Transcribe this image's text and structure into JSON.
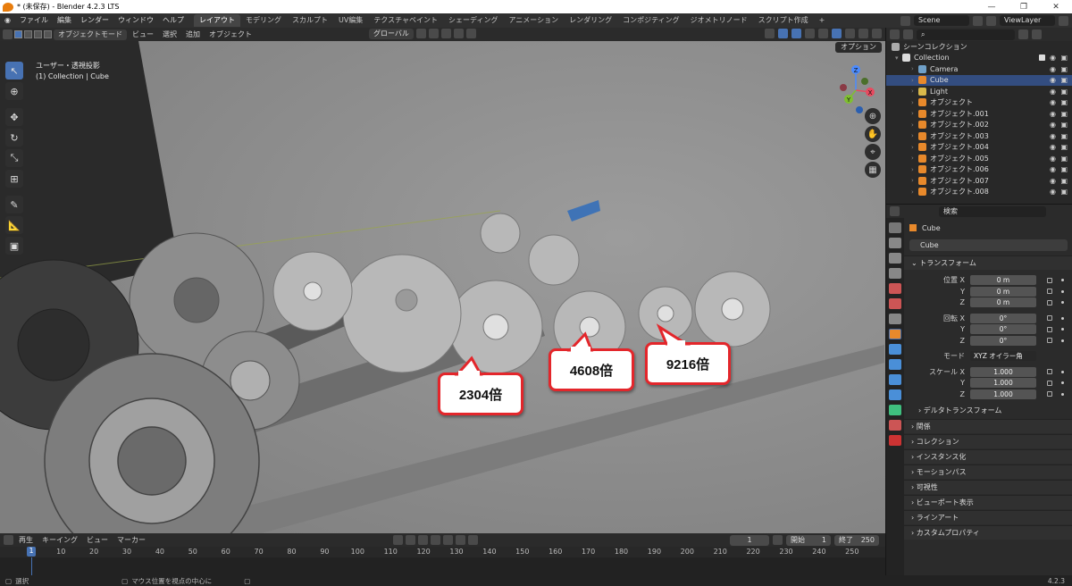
{
  "window": {
    "title": "* (未保存) - Blender 4.2.3 LTS",
    "controls": [
      "—",
      "❐",
      "✕"
    ]
  },
  "menubar": {
    "menus": [
      "ファイル",
      "編集",
      "レンダー",
      "ウィンドウ",
      "ヘルプ"
    ],
    "workspaces": [
      "レイアウト",
      "モデリング",
      "スカルプト",
      "UV編集",
      "テクスチャペイント",
      "シェーディング",
      "アニメーション",
      "レンダリング",
      "コンポジティング",
      "ジオメトリノード",
      "スクリプト作成"
    ],
    "add_tab": "+",
    "scene": "Scene",
    "view_layer": "ViewLayer"
  },
  "viewport": {
    "mode": "オブジェクトモード",
    "menus": [
      "ビュー",
      "選択",
      "追加",
      "オブジェクト"
    ],
    "transform_orientation": "グローバル",
    "options": "オプション",
    "info_line1": "ユーザー・透視投影",
    "info_line2": "(1) Collection | Cube",
    "gizmo_axes": [
      "X",
      "Y",
      "Z"
    ]
  },
  "callouts": [
    "2304倍",
    "4608倍",
    "9216倍"
  ],
  "timeline": {
    "menus": [
      "再生",
      "キーイング",
      "ビュー",
      "マーカー"
    ],
    "current_frame": "1",
    "start_label": "開始",
    "start": "1",
    "end_label": "終了",
    "end": "250",
    "ruler": [
      "1",
      "10",
      "20",
      "30",
      "40",
      "50",
      "60",
      "70",
      "80",
      "90",
      "100",
      "110",
      "120",
      "130",
      "140",
      "150",
      "160",
      "170",
      "180",
      "190",
      "200",
      "210",
      "220",
      "230",
      "240",
      "250"
    ]
  },
  "statusbar": {
    "left": "選択",
    "middle": "マウス位置を視点の中心に",
    "version": "4.2.3"
  },
  "outliner": {
    "search_placeholder": "",
    "root": "シーンコレクション",
    "collection": "Collection",
    "items": [
      "Camera",
      "Cube",
      "Light",
      "オブジェクト",
      "オブジェクト.001",
      "オブジェクト.002",
      "オブジェクト.003",
      "オブジェクト.004",
      "オブジェクト.005",
      "オブジェクト.006",
      "オブジェクト.007",
      "オブジェクト.008"
    ]
  },
  "properties": {
    "search_placeholder": "検索",
    "object_name": "Cube",
    "object_field": "Cube",
    "transform_header": "トランスフォーム",
    "location_label": "位置 X",
    "location": [
      "0 m",
      "0 m",
      "0 m"
    ],
    "rotation_label": "回転 X",
    "rotation": [
      "0°",
      "0°",
      "0°"
    ],
    "mode_label": "モード",
    "mode_value": "XYZ オイラー角",
    "scale_label": "スケール X",
    "scale": [
      "1.000",
      "1.000",
      "1.000"
    ],
    "axis_y": "Y",
    "axis_z": "Z",
    "delta": "デルタトランスフォーム",
    "panels": [
      "関係",
      "コレクション",
      "インスタンス化",
      "モーションパス",
      "可視性",
      "ビューポート表示",
      "ラインアート",
      "カスタムプロパティ"
    ]
  },
  "colors": {
    "accent": "#4772b3",
    "callout_border": "#e3262b",
    "selected_row": "#334d80"
  }
}
